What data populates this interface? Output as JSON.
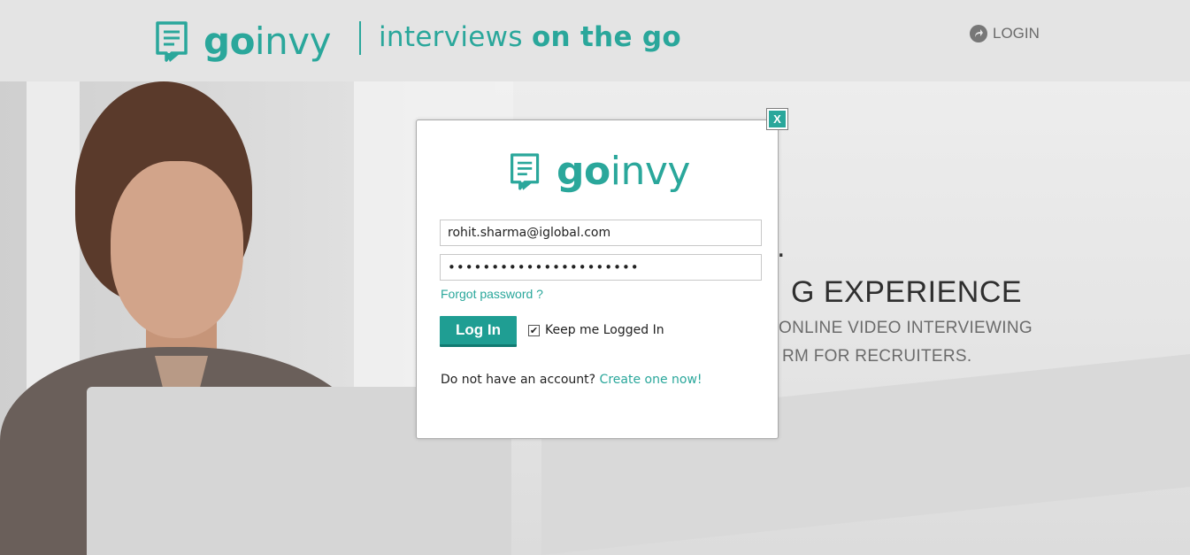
{
  "header": {
    "brand_go": "go",
    "brand_invy": "invy",
    "tagline_regular": "interviews ",
    "tagline_bold": "on the go",
    "login_label": "LOGIN"
  },
  "hero": {
    "line1": ".",
    "headline": "G EXPERIENCE",
    "sub1": "ONLINE VIDEO INTERVIEWING",
    "sub2": "RM FOR RECRUITERS."
  },
  "modal": {
    "close_label": "X",
    "brand_go": "go",
    "brand_invy": "invy",
    "email_value": "rohit.sharma@iglobal.com",
    "password_masked": "••••••••••••••••••••••",
    "forgot_label": "Forgot password ?",
    "login_button": "Log In",
    "keep_logged_in_label": "Keep me Logged In",
    "keep_logged_in_checked": true,
    "no_account_text": "Do not have an account? ",
    "create_link": "Create one now!"
  },
  "colors": {
    "brand": "#2aa79b",
    "button": "#1f9e93",
    "header_bg": "#e4e4e4"
  },
  "icons": {
    "logo": "doc-chat-icon",
    "login": "arrow-login-icon",
    "checkbox": "check-icon"
  }
}
